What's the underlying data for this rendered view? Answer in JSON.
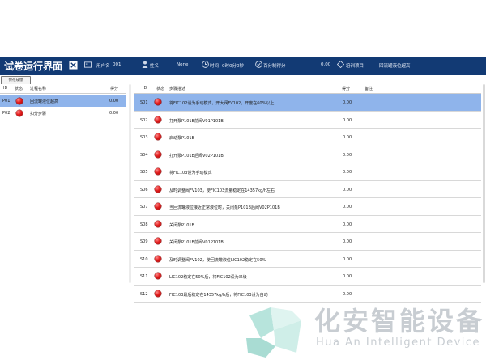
{
  "header": {
    "title": "试卷运行界面",
    "user_label": "用户名",
    "user_value": "001",
    "name_label": "姓名",
    "name_value": "None",
    "time_label": "时间",
    "time_value": "0时0分0秒",
    "score_label": "百分制得分",
    "score_value": "0.00",
    "training_label": "培训项目",
    "training_value": "回流罐液位超高"
  },
  "toolbar": {
    "save_label": "保存成绩"
  },
  "left_table": {
    "headers": {
      "id": "ID",
      "status": "状态",
      "name": "过程名称",
      "score": "得分"
    },
    "rows": [
      {
        "id": "P01",
        "name": "回流罐液位超高",
        "score": "0.00",
        "selected": true
      },
      {
        "id": "P02",
        "name": "扣分步骤",
        "score": "0.00",
        "selected": false
      }
    ]
  },
  "right_table": {
    "headers": {
      "id": "ID",
      "status": "状态",
      "desc": "步骤描述",
      "score": "得分",
      "note": "备注"
    },
    "rows": [
      {
        "id": "S01",
        "desc": "将FIC102设为手动模式，开大阀FV102，开度在60%以上",
        "score": "0.00",
        "selected": true
      },
      {
        "id": "S02",
        "desc": "打开泵P101B前阀V01P101B",
        "score": "0.00",
        "selected": false
      },
      {
        "id": "S03",
        "desc": "启动泵P101B",
        "score": "0.00",
        "selected": false
      },
      {
        "id": "S04",
        "desc": "打开泵P101B后阀V02P101B",
        "score": "0.00",
        "selected": false
      },
      {
        "id": "S05",
        "desc": "将FIC103设为手动模式",
        "score": "0.00",
        "selected": false
      },
      {
        "id": "S06",
        "desc": "及时调整阀FV103，使FIC103流量稳定在14357kg/h左右",
        "score": "0.00",
        "selected": false
      },
      {
        "id": "S07",
        "desc": "当回流罐液位接近正常液位时，关闭泵P101B后阀V02P101B",
        "score": "0.00",
        "selected": false
      },
      {
        "id": "S08",
        "desc": "关闭泵P101B",
        "score": "0.00",
        "selected": false
      },
      {
        "id": "S09",
        "desc": "关闭泵P101B前阀V01P101B",
        "score": "0.00",
        "selected": false
      },
      {
        "id": "S10",
        "desc": "及时调整阀FV102，使回流罐液位LIC102稳定在50%",
        "score": "0.00",
        "selected": false
      },
      {
        "id": "S11",
        "desc": "LIC102稳定在50%后，将FIC102设为串级",
        "score": "0.00",
        "selected": false
      },
      {
        "id": "S12",
        "desc": "FIC103最后稳定在14357kg/h后，将FIC103设为自动",
        "score": "0.00",
        "selected": false
      }
    ]
  },
  "watermark": {
    "cn": "化安智能设备",
    "en": "Hua An Intelligent Device"
  },
  "icons": {
    "user": "id-card-icon",
    "name": "person-icon",
    "time": "clock-icon",
    "score": "score-icon",
    "training": "training-icon",
    "logo": "huaan-logo-icon",
    "status": "red-status-dot-icon"
  }
}
